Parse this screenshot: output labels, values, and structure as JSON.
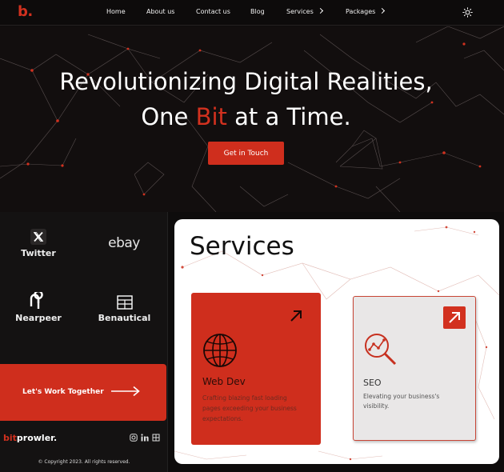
{
  "nav": {
    "logo": "b.",
    "links": [
      "Home",
      "About us",
      "Contact us",
      "Blog",
      "Services",
      "Packages"
    ]
  },
  "hero": {
    "line1": "Revolutionizing Digital Realities,",
    "line2_before": "One ",
    "line2_accent": "Bit",
    "line2_after": " at a Time.",
    "cta": "Get in Touch"
  },
  "clients": [
    "Twitter",
    "ebay",
    "Nearpeer",
    "Benautical"
  ],
  "work": {
    "label": "Let's Work Together"
  },
  "footer": {
    "brand_bit": "bit",
    "brand_rest": "prowler.",
    "copyright": "© Copyright 2023. All rights reserved."
  },
  "services": {
    "title": "Services",
    "cards": [
      {
        "title": "Web Dev",
        "desc": "Crafting blazing fast loading pages exceeding your business expectations."
      },
      {
        "title": "SEO",
        "desc": "Elevating your business's visibility."
      }
    ]
  },
  "colors": {
    "accent": "#cf2e1d",
    "dark": "#120e0e"
  },
  "icons": [
    "sun-icon",
    "chevron-right-icon",
    "x-logo-icon",
    "nearpeer-logo-icon",
    "benautical-logo-icon",
    "arrow-right-icon",
    "instagram-icon",
    "linkedin-icon",
    "social-icon",
    "globe-icon",
    "seo-magnifier-icon",
    "arrow-up-right-icon"
  ]
}
